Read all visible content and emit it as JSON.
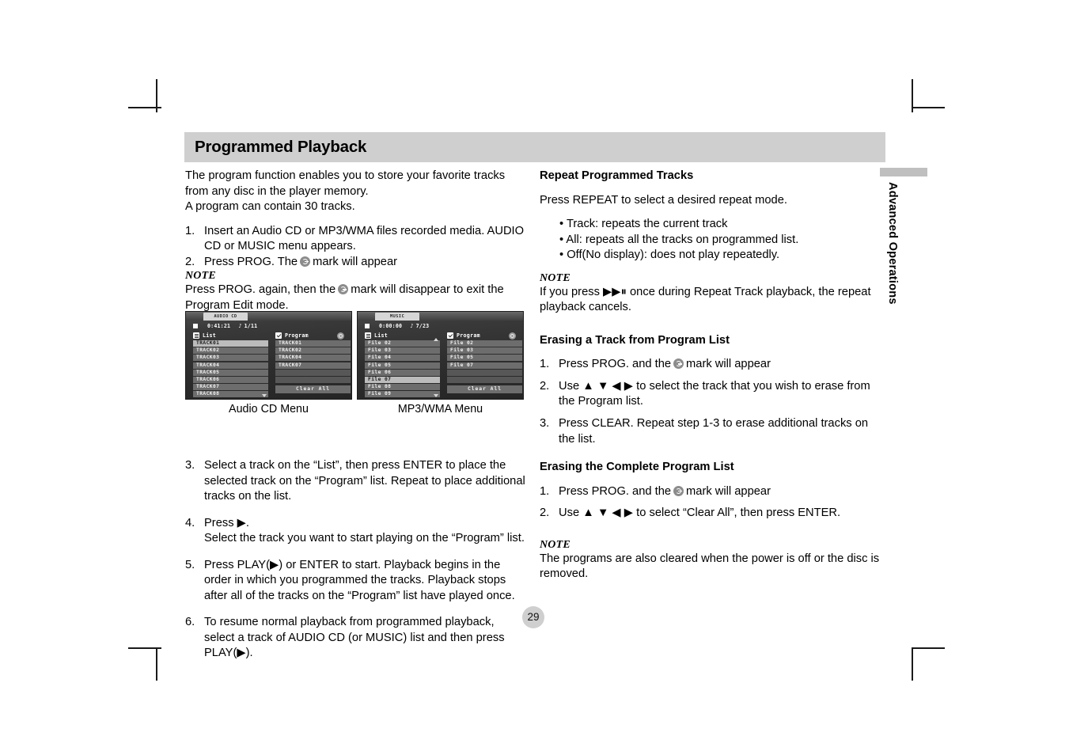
{
  "page": {
    "title": "Programmed Playback",
    "number": "29",
    "side_tab": "Advanced Operations"
  },
  "left_column": {
    "intro": [
      "The program function enables you to store your favorite tracks",
      "from any disc in the player memory.",
      "A program can contain 30 tracks."
    ],
    "steps_1_2": [
      {
        "num": "1.",
        "text": "Insert an Audio CD or MP3/WMA files recorded media. AUDIO CD or MUSIC menu appears."
      },
      {
        "num": "2.",
        "text_before": "Press PROG. The",
        "icon": "prog-mark-icon",
        "text_after": "mark will appear"
      }
    ],
    "note_label": "NOTE",
    "note_text_before": "Press PROG. again, then the",
    "note_icon": "prog-mark-icon",
    "note_text_after": "mark will disappear to exit the Program Edit mode.",
    "steps_3_6": [
      {
        "num": "3.",
        "text": "Select a track on the “List”, then press ENTER to place the selected track on the “Program” list. Repeat to place additional tracks on the list."
      },
      {
        "num": "4.",
        "text": "Press ▶.\nSelect the track you want to start playing on the “Program” list."
      },
      {
        "num": "5.",
        "text": "Press PLAY(▶) or ENTER to start. Playback begins in the order in which you programmed the tracks. Playback stops after all of the tracks on the “Program” list have played once."
      },
      {
        "num": "6.",
        "text": "To resume normal playback from programmed playback, select a track of AUDIO CD (or MUSIC) list and then press PLAY(▶)."
      }
    ]
  },
  "right_column": {
    "repeat_heading": "Repeat Programmed Tracks",
    "repeat_intro": "Press REPEAT to select a desired repeat mode.",
    "repeat_bullets": [
      "• Track: repeats the current track",
      "• All: repeats all the tracks on programmed list.",
      "• Off(No display): does not play repeatedly."
    ],
    "note1_label": "NOTE",
    "note1_text": "If you press ▶▶⏸ once during Repeat Track playback, the repeat playback cancels.",
    "erase_track_heading": "Erasing a Track from Program List",
    "erase_track_steps": [
      {
        "num": "1.",
        "text_before": "Press PROG. and the",
        "icon": "prog-mark-icon",
        "text_after": "mark will appear"
      },
      {
        "num": "2.",
        "text": "Use ▲ ▼ ◀ ▶ to select the track that you wish to erase from the Program list."
      },
      {
        "num": "3.",
        "text": "Press CLEAR. Repeat step 1-3 to erase additional tracks on the list."
      }
    ],
    "erase_all_heading": "Erasing the Complete Program List",
    "erase_all_steps": [
      {
        "num": "1.",
        "text_before": "Press PROG. and the",
        "icon": "prog-mark-icon",
        "text_after": "mark will appear"
      },
      {
        "num": "2.",
        "text": "Use ▲ ▼ ◀ ▶ to select “Clear All”, then press ENTER."
      }
    ],
    "note2_label": "NOTE",
    "note2_text": "The programs are also cleared when the power is off or the disc is removed."
  },
  "osd_audio": {
    "caption": "Audio CD Menu",
    "tab": "AUDIO CD",
    "time": "0:41:21",
    "track_counter": "1/11",
    "list_header": "List",
    "program_header": "Program",
    "clear_all": "Clear  All",
    "list_items": [
      "TRACK01",
      "TRACK02",
      "TRACK03",
      "TRACK04",
      "TRACK05",
      "TRACK06",
      "TRACK07",
      "TRACK08"
    ],
    "list_selected_index": 0,
    "program_items": [
      "TRACK01",
      "TRACK02",
      "TRACK04",
      "TRACK07",
      "",
      ""
    ]
  },
  "osd_mp3": {
    "caption": "MP3/WMA Menu",
    "tab": "MUSIC",
    "time": "0:00:00",
    "track_counter": "7/23",
    "list_header": "List",
    "program_header": "Program",
    "clear_all": "Clear  All",
    "list_items": [
      "File 02",
      "File 03",
      "File 04",
      "File 05",
      "File 06",
      "File 07",
      "File 08",
      "File 09"
    ],
    "list_selected_index": 5,
    "program_items": [
      "File 02",
      "File 03",
      "File 05",
      "File 07",
      "",
      ""
    ]
  }
}
